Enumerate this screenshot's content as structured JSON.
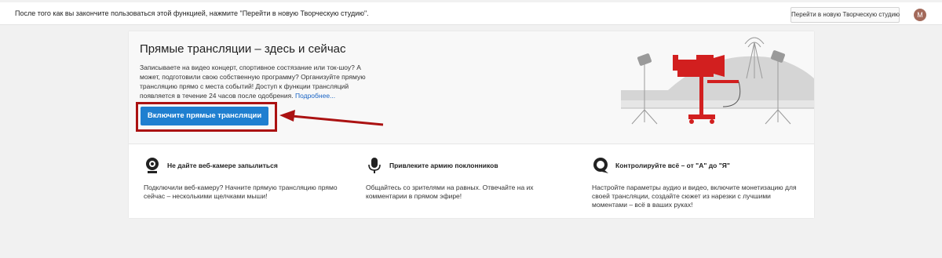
{
  "topbar": {
    "notice": "После того как вы закончите пользоваться этой функцией, нажмите \"Перейти в новую Творческую студию\".",
    "studio_button": "Перейти в новую Творческую студию",
    "avatar_letter": "М"
  },
  "hero": {
    "title": "Прямые трансляции – здесь и сейчас",
    "description": "Записываете на видео концерт, спортивное состязание или ток-шоу? А может, подготовили свою собственную программу? Организуйте прямую трансляцию прямо с места событий! Доступ к функции трансляций появляется в течение 24 часов после одобрения.",
    "more_link": "Подробнее...",
    "enable_button": "Включите прямые трансляции"
  },
  "features": [
    {
      "icon": "webcam-icon",
      "title": "Не дайте веб-камере запылиться",
      "description": "Подключили веб-камеру? Начните прямую трансляцию прямо сейчас – несколькими щелчками мыши!"
    },
    {
      "icon": "microphone-icon",
      "title": "Привлеките армию поклонников",
      "description": "Общайтесь со зрителями на равных. Отвечайте на их комментарии в прямом эфире!"
    },
    {
      "icon": "chat-bubble-icon",
      "title": "Контролируйте всё – от \"А\" до \"Я\"",
      "description": "Настройте параметры аудио и видео, включите монетизацию для своей трансляции, создайте сюжет из нарезки с лучшими моментами – всё в ваших руках!"
    }
  ],
  "colors": {
    "accent_button": "#1f7fd0",
    "highlight_frame": "#ab1212",
    "camera_red": "#d21f1f"
  }
}
